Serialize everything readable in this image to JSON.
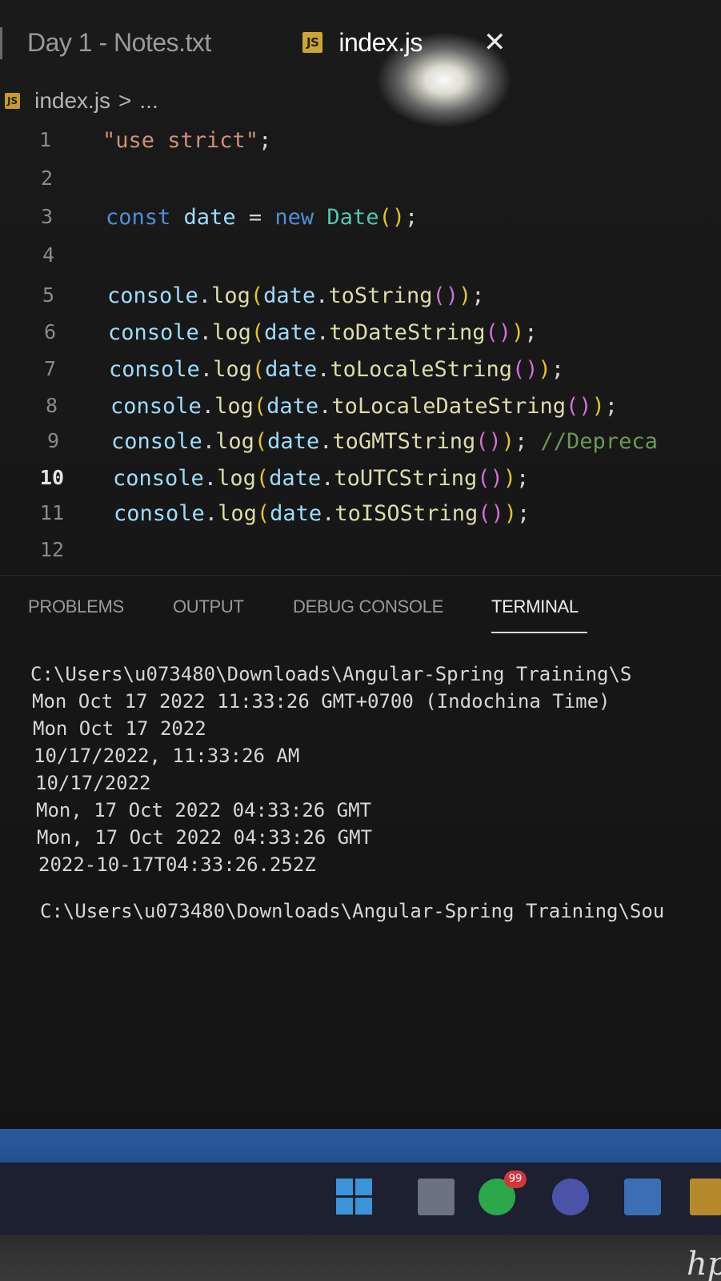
{
  "tabs": [
    {
      "label": "Day 1 - Notes.txt"
    },
    {
      "label": "index.js",
      "icon": "JS",
      "close": "✕"
    }
  ],
  "breadcrumb": {
    "icon": "JS",
    "file": "index.js",
    "separator": ">",
    "rest": "..."
  },
  "editor": {
    "lines": [
      {
        "n": "1",
        "text": "\"use strict\";"
      },
      {
        "n": "2",
        "text": ""
      },
      {
        "n": "3",
        "text": "const date = new Date();"
      },
      {
        "n": "4",
        "text": ""
      },
      {
        "n": "5",
        "text": "console.log(date.toString());"
      },
      {
        "n": "6",
        "text": "console.log(date.toDateString());"
      },
      {
        "n": "7",
        "text": "console.log(date.toLocaleString());"
      },
      {
        "n": "8",
        "text": "console.log(date.toLocaleDateString());"
      },
      {
        "n": "9",
        "text": "console.log(date.toGMTString()); //Depreca"
      },
      {
        "n": "10",
        "text": "console.log(date.toUTCString());"
      },
      {
        "n": "11",
        "text": "console.log(date.toISOString());"
      },
      {
        "n": "12",
        "text": ""
      }
    ],
    "active_line": "10"
  },
  "panel": {
    "tabs": [
      "PROBLEMS",
      "OUTPUT",
      "DEBUG CONSOLE",
      "TERMINAL"
    ],
    "active_tab": "TERMINAL"
  },
  "terminal": {
    "lines": [
      "C:\\Users\\u073480\\Downloads\\Angular-Spring Training\\S",
      "Mon Oct 17 2022 11:33:26 GMT+0700 (Indochina Time)",
      "Mon Oct 17 2022",
      "10/17/2022, 11:33:26 AM",
      "10/17/2022",
      "Mon, 17 Oct 2022 04:33:26 GMT",
      "Mon, 17 Oct 2022 04:33:26 GMT",
      "2022-10-17T04:33:26.252Z",
      "C:\\Users\\u073480\\Downloads\\Angular-Spring Training\\Sou"
    ]
  },
  "taskbar": {
    "whatsapp_badge": "99",
    "brand": "hp"
  },
  "colors": {
    "keyword": "#4f8fd6",
    "variable": "#9cdcfe",
    "class": "#4ec9b0",
    "function": "#dcdcaa",
    "string": "#ce9178",
    "paren1": "#e2c429",
    "paren2": "#d070d6",
    "comment": "#6a9955"
  }
}
